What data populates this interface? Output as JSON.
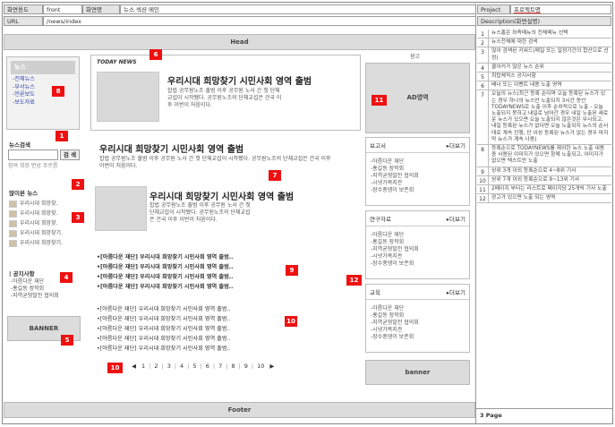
{
  "header": {
    "screen_id_label": "화면용도",
    "screen_id_value": "front",
    "screen_name_label": "화면명",
    "screen_name_value": "뉴스 섹션 메인",
    "url_label": "URL",
    "url_value": "/news/index",
    "project_label": "Project",
    "project_value": "프로젝트명",
    "description_label": "Description(화면설명)"
  },
  "bars": {
    "head": "Head",
    "footer": "Footer"
  },
  "left": {
    "menu_title": "뉴스",
    "menu_items": [
      "-전체뉴스",
      "-부서뉴스",
      "-언론보도",
      "-보도자료"
    ],
    "search_title": "뉴스검색",
    "search_button": "검 색",
    "search_tags": "참여 희망 변성 주르름",
    "viewed_title": "많이본 뉴스",
    "viewed_items": [
      "우리시대 희망찾.",
      "우리시대 희망찾.",
      "우리시대 희망찾.",
      "우리시대 희망찾기.",
      "우리시대 희망찾기."
    ],
    "notice_title": "| 공지사항",
    "notice_items": [
      "-아름다운 재단",
      "-홍길동 장학회",
      "-지역균형발전 협의회"
    ],
    "banner": "BANNER"
  },
  "main": {
    "today_label": "TODAY NEWS",
    "featured_title": "우리시대 희망찾기 시민사회 영역 출범",
    "featured_body": "합법 공무원노조 출범 이후 공무원 노사 간 첫 단체교섭이 시작됐다. 공무원노조의 단체교섭은 건국 이후 이번이 처음이다.",
    "article2_title": "우리시대 희망찾기 시민사회 영역 출범",
    "article2_body": "합법 공무원노조 출범 이후 공무원 노사 간 첫 단체교섭이 시작됐다. 공무원노조의 단체교섭은 건국 이후 이번이 처음이다.",
    "article3_title": "우리시대 희망찾기 시민사회 영역 출범",
    "article3_body": "합법 공무원노조 출범 이후 공무원 노사 간 첫 단체교섭이 시작됐다. 공무원노조의 단체교섭은 건국 이후 이번이 처음이다.",
    "bold_list": [
      "•[아름다운 재단] 우리시대 희망찾기 시민사회 영역 출범..",
      "•[아름다운 재단] 우리시대 희망찾기 시민사회 영역 출범..",
      "•[아름다운 재단] 우리시대 희망찾기 시민사회 영역 출범..",
      "•[아름다운 재단] 우리시대 희망찾기 시민사회 영역 출범.."
    ],
    "plain_list": [
      "•[아름다운 재단] 우리시대 희망찾기 시민사회 영역 출범..",
      "•[아름다운 재단] 우리시대 희망찾기 시민사회 영역 출범..",
      "•[아름다운 재단] 우리시대 희망찾기 시민사회 영역 출범..",
      "•[아름다운 재단] 우리시대 희망찾기 시민사회 영역 출범..",
      "•[아름다운 재단] 우리시대 희망찾기 시민사회 영역 출범.."
    ],
    "pages": [
      "1",
      "2",
      "3",
      "4",
      "5",
      "6",
      "7",
      "8",
      "9",
      "10"
    ],
    "prev": "◀",
    "next": "▶"
  },
  "rightcol": {
    "ad_title": "광고",
    "ad_label": "AD영역",
    "sections": [
      {
        "title": "보고서",
        "more": "▸더보기",
        "items": [
          "-아름다운 재단",
          "-홍길동 장학회",
          "-지역균형발전 협의회",
          "-시냇가복지관",
          "-장수풍뎅이 보존회"
        ]
      },
      {
        "title": "연구자료",
        "more": "▸더보기",
        "items": [
          "-아름다운 재단",
          "-홍길동 장학회",
          "-지역균형발전 협의회",
          "-시냇가복지관",
          "-장수풍뎅이 보존회"
        ]
      },
      {
        "title": "교육",
        "more": "▸더보기",
        "items": [
          "-아름다운 재단",
          "-홍길동 장학회",
          "-지역균형발전 협의회",
          "-시냇가복지관",
          "-장수풍뎅이 보존회"
        ]
      }
    ],
    "banner": "banner"
  },
  "badges": [
    "1",
    "2",
    "3",
    "4",
    "5",
    "6",
    "7",
    "8",
    "9",
    "10",
    "11",
    "12"
  ],
  "descriptions": [
    {
      "n": "1",
      "text": "뉴스홈은 좌측메뉴의 전체메뉴 선택"
    },
    {
      "n": "2",
      "text": "뉴스전체에 대한 검색"
    },
    {
      "n": "3",
      "text": "많이 검색된 키워드(매일 또는 일정기간의 합산으로 선정)"
    },
    {
      "n": "4",
      "text": "클이커가 많은 뉴스 순위"
    },
    {
      "n": "5",
      "text": "최탑체적스 공지사항"
    },
    {
      "n": "6",
      "text": "배너 또는 이벤트 내용 노출 영역"
    },
    {
      "n": "7",
      "text": "오늘의 뉴스(최근 등록 순이며 오늘 등록된 뉴스가 있는 경우 하나의 뉴스만 노출되지 3시간 동안 TODAYNEWS로 노출 이후 순차적으로 노출 - 오늘 노출되지 못하고 내일로 넘어간 경우 내일 노출된 새로운 뉴스가 있으면 오늘 노출되지 않은것은 무시되고, 내일 등록된 뉴스가 없다면 오늘 노출되지 뉴스의 순서대로 계속 진행, 단 이상 등록된 뉴스가 없는 경우 마지막 뉴스가 계속 나옴)"
    },
    {
      "n": "8",
      "text": "등록순으로 TODAYNEWS를 제외한 뉴스 노출 내용중 사용된 이미지가 있으면 함께 노출되고, 이미지가 없으면 텍스트만 노출"
    },
    {
      "n": "9",
      "text": "상위 3개 이외 등록순으로 4~8위 기사"
    },
    {
      "n": "10",
      "text": "상위 7개 이외 등록순으로 9~13위 기사"
    },
    {
      "n": "11",
      "text": "2페이지 부터는 리스트로 페이지당 25개씩 기사 노출"
    },
    {
      "n": "12",
      "text": "광고가 있으면 노출 되는 영역"
    }
  ],
  "page_footer": "3 Page"
}
